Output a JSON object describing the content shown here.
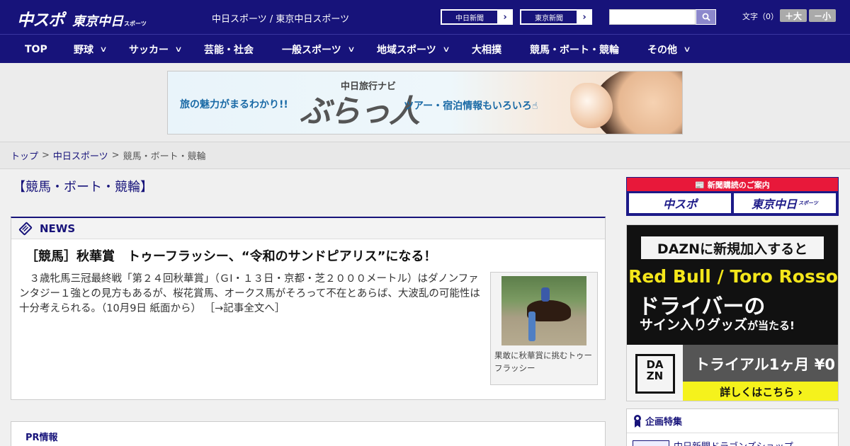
{
  "header": {
    "logo_main": "中スポ",
    "logo_tokyo": "東京中日",
    "logo_tokyo_sub": "スポーツ",
    "site_links": "中日スポーツ / 東京中日スポーツ",
    "btn_chunichi": "中日新聞",
    "btn_tokyo": "東京新聞",
    "arrow": "›",
    "search_placeholder": "",
    "font_label": "文字（0）",
    "font_plus": "＋大",
    "font_minus": "－小"
  },
  "nav": {
    "items": [
      {
        "label": "TOP",
        "dropdown": false
      },
      {
        "label": "野球",
        "dropdown": true
      },
      {
        "label": "サッカー",
        "dropdown": true
      },
      {
        "label": "芸能・社会",
        "dropdown": false
      },
      {
        "label": "一般スポーツ",
        "dropdown": true
      },
      {
        "label": "地域スポーツ",
        "dropdown": true
      },
      {
        "label": "大相撲",
        "dropdown": false
      },
      {
        "label": "競馬・ボート・競輪",
        "dropdown": false
      },
      {
        "label": "その他",
        "dropdown": true
      }
    ],
    "chevron": "∨"
  },
  "banner": {
    "tagline_left": "旅の魅力がまるわかり!!",
    "navi": "中日旅行ナビ",
    "brand": "ぶらっ人",
    "tagline_right": "ツアー・宿泊情報もいろいろ☝"
  },
  "breadcrumb": {
    "home": "トップ",
    "section": "中日スポーツ",
    "current": "競馬・ボート・競輪",
    "sep": ">"
  },
  "page_title": "【競馬・ボート・競輪】",
  "news": {
    "label": "NEWS",
    "headline": "［競馬］秋華賞　トゥーフラッシー、“令和のサンドピアリス”になる！",
    "summary": "　３歳牝馬三冠最終戦「第２４回秋華賞」（ＧⅠ・１３日・京都・芝２０００メートル）はダノンファンタジー１強との見方もあるが、桜花賞馬、オークス馬がそろって不在とあらば、大波乱の可能性は十分考えられる。（10月9日 紙面から）",
    "more": "［→記事全文へ］",
    "photo_caption": "果敢に秋華賞に挑むトゥーフラッシー"
  },
  "pr": {
    "label": "PR情報"
  },
  "subscription_ad": {
    "strip": "📰 新聞購読のご案内",
    "cell1": "中スポ",
    "cell2": "東京中日",
    "cell2_sub": "スポーツ"
  },
  "dazn_ad": {
    "topline": "DAZNに新規加入すると",
    "rb": "Red Bull / Toro Rosso",
    "driver": "ドライバーの",
    "sign": "サイン入りグッズ",
    "sign_suffix": "が当たる!",
    "logo": "DA ZN",
    "trial": "トライアル1ヶ月 ¥0",
    "cta": "詳しくはこちら ›"
  },
  "feature": {
    "label": "企画特集",
    "item": "中日新聞ドラゴンズショップ"
  },
  "colors": {
    "brand_navy": "#17137a",
    "accent_red": "#e8183a",
    "dazn_yellow": "#f5f21c"
  }
}
